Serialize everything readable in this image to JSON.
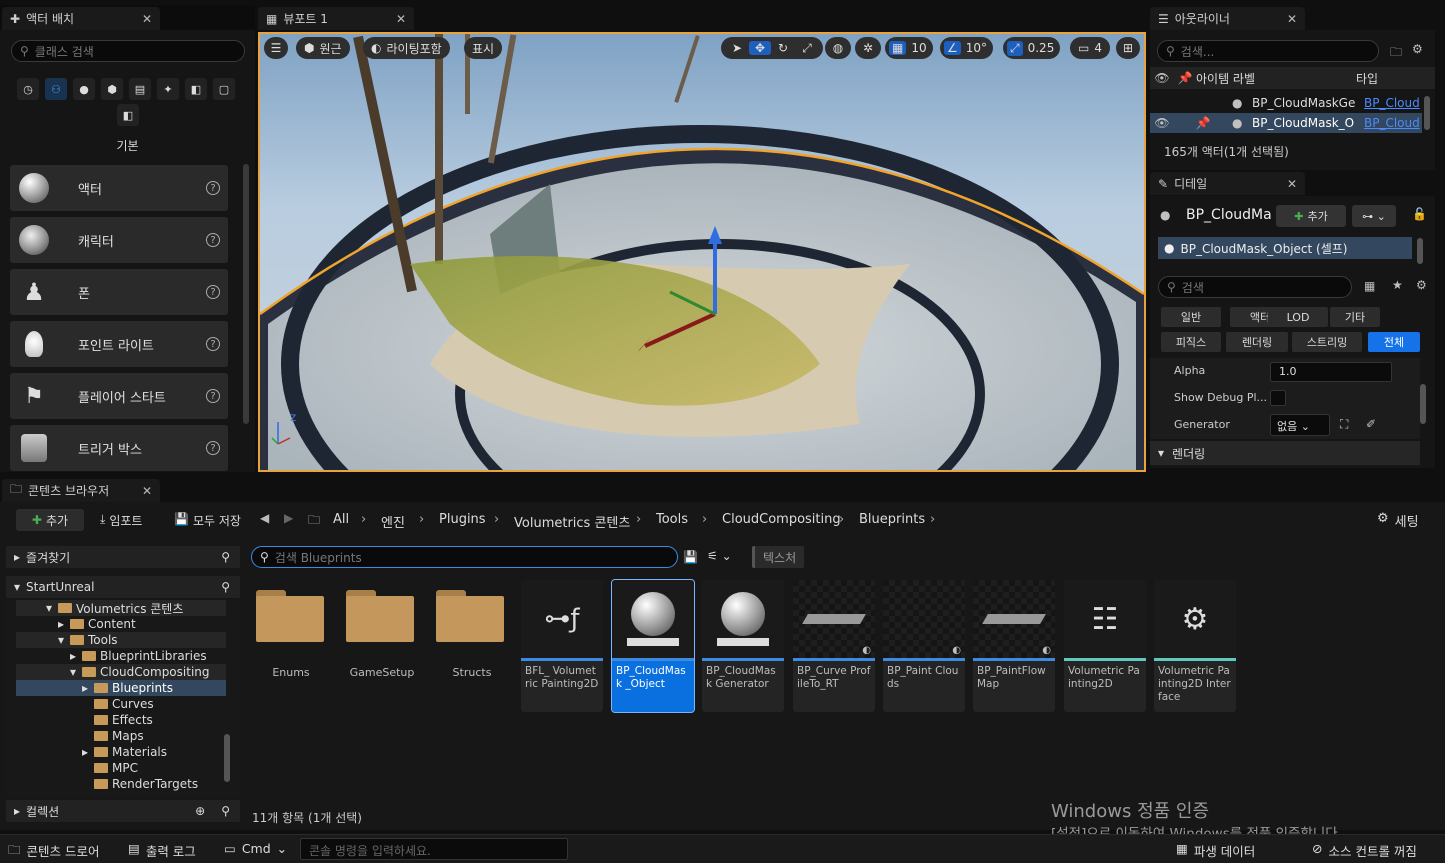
{
  "place_actors": {
    "tab_title": "액터 배치",
    "search_placeholder": "클래스 검색",
    "category_label": "기본",
    "items": [
      {
        "label": "액터",
        "icon": "sphere-icon"
      },
      {
        "label": "캐릭터",
        "icon": "character-icon"
      },
      {
        "label": "폰",
        "icon": "pawn-icon"
      },
      {
        "label": "포인트 라이트",
        "icon": "lightbulb-icon"
      },
      {
        "label": "플레이어 스타트",
        "icon": "player-start-icon"
      },
      {
        "label": "트리거 박스",
        "icon": "trigger-box-icon"
      }
    ]
  },
  "viewport": {
    "tab_title": "뷰포트 1",
    "perspective": "원근",
    "lighting": "라이팅포함",
    "show": "표시",
    "grid_snap": "10",
    "rotation_snap": "10°",
    "scale_snap": "0.25",
    "camera_speed": "4",
    "axis_z": "Z"
  },
  "outliner": {
    "tab_title": "아웃라이너",
    "search_placeholder": "검색...",
    "col_label": "아이템 라벨",
    "col_type": "타입",
    "rows": [
      {
        "label": "BP_CloudMaskGe",
        "type": "BP_Cloud"
      },
      {
        "label": "BP_CloudMask_O",
        "type": "BP_Cloud"
      }
    ],
    "status": "165개 액터(1개 선택됨)"
  },
  "details": {
    "tab_title": "디테일",
    "object_name": "BP_CloudMa",
    "add_label": "추가",
    "component": "BP_CloudMask_Object (셀프)",
    "search_placeholder": "검색",
    "categories_row1": [
      "일반",
      "액터",
      "LOD",
      "기타"
    ],
    "categories_row2": [
      "피직스",
      "렌더링",
      "스트리밍",
      "전체"
    ],
    "props": [
      {
        "name": "Alpha",
        "value": "1.0"
      },
      {
        "name": "Show Debug Pl...",
        "value": ""
      },
      {
        "name": "Generator",
        "value": "없음"
      }
    ],
    "section": "렌더링"
  },
  "content_browser": {
    "tab_title": "콘텐츠 브라우저",
    "add_label": "추가",
    "import_label": "임포트",
    "save_all_label": "모두 저장",
    "settings_label": "세팅",
    "breadcrumbs": [
      "All",
      "엔진",
      "Plugins",
      "Volumetrics 콘텐츠",
      "Tools",
      "CloudCompositing",
      "Blueprints"
    ],
    "favorites_label": "즐겨찾기",
    "project_label": "StartUnreal",
    "collections_label": "컬렉션",
    "tree": [
      "Volumetrics 콘텐츠",
      "Content",
      "Tools",
      "BlueprintLibraries",
      "CloudCompositing",
      "Blueprints",
      "Curves",
      "Effects",
      "Maps",
      "Materials",
      "MPC",
      "RenderTargets"
    ],
    "search_placeholder": "검색 Blueprints",
    "filter_chip": "텍스처",
    "folders": [
      "Enums",
      "GameSetup",
      "Structs"
    ],
    "assets": [
      "BFL_ Volumetric Painting2D",
      "BP_CloudMask _Object",
      "BP_CloudMask Generator",
      "BP_Curve ProfileTo_RT",
      "BP_Paint Clouds",
      "BP_PaintFlow Map",
      "Volumetric Painting2D",
      "Volumetric Painting2D Interface"
    ],
    "item_count": "11개 항목 (1개 선택)"
  },
  "statusbar": {
    "content_drawer": "콘텐츠 드로어",
    "output_log": "출력 로그",
    "cmd": "Cmd",
    "console_placeholder": "콘솔 명령을 입력하세요.",
    "derived_data": "파생 데이터",
    "source_control": "소스 컨트롤 꺼짐"
  },
  "watermark": {
    "line1": "Windows 정품 인증",
    "line2": "[설정]으로 이동하여 Windows를 정품 인증합니다."
  }
}
